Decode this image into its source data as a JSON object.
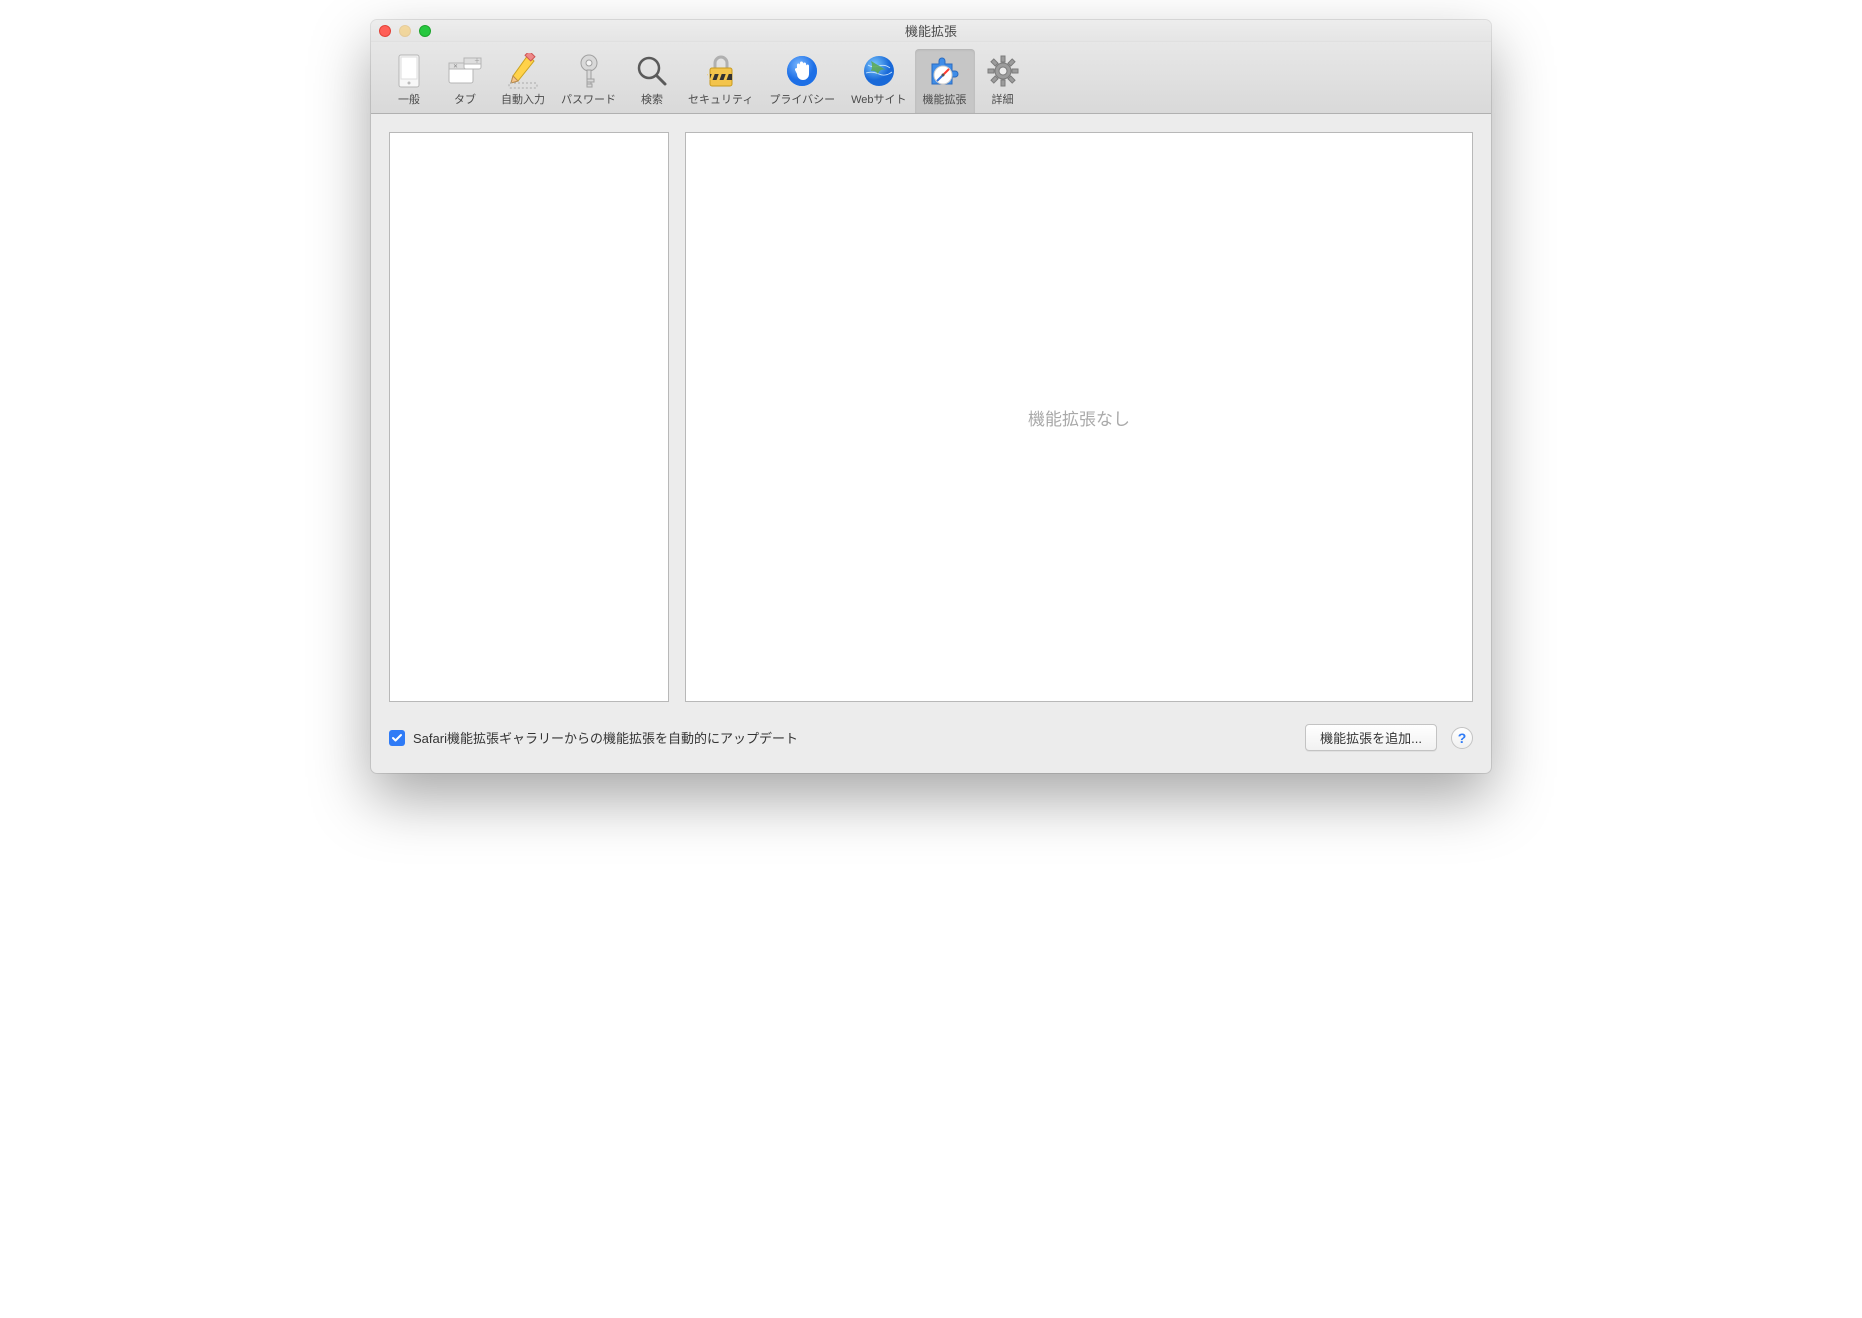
{
  "window": {
    "title": "機能拡張"
  },
  "toolbar": {
    "items": [
      {
        "id": "general",
        "label": "一般"
      },
      {
        "id": "tabs",
        "label": "タブ"
      },
      {
        "id": "autofill",
        "label": "自動入力"
      },
      {
        "id": "passwords",
        "label": "パスワード"
      },
      {
        "id": "search",
        "label": "検索"
      },
      {
        "id": "security",
        "label": "セキュリティ"
      },
      {
        "id": "privacy",
        "label": "プライバシー"
      },
      {
        "id": "websites",
        "label": "Webサイト"
      },
      {
        "id": "extensions",
        "label": "機能拡張",
        "selected": true
      },
      {
        "id": "advanced",
        "label": "詳細"
      }
    ]
  },
  "main": {
    "empty_message": "機能拡張なし"
  },
  "footer": {
    "auto_update_checked": true,
    "auto_update_label": "Safari機能拡張ギャラリーからの機能拡張を自動的にアップデート",
    "add_button_label": "機能拡張を追加...",
    "help_label": "?"
  }
}
